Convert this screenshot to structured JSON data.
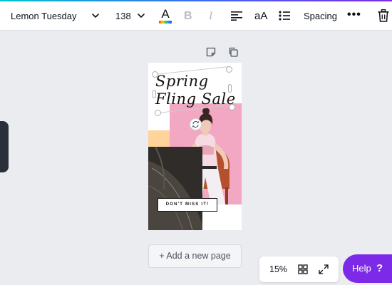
{
  "toolbar": {
    "font_name": "Lemon Tuesday",
    "font_size": "138",
    "text_color_letter": "A",
    "bold_label": "B",
    "italic_label": "I",
    "case_label": "aA",
    "spacing_label": "Spacing",
    "more_label": "•••"
  },
  "design": {
    "headline": "Spring Fling Sale",
    "cta": "DON'T MISS IT!"
  },
  "canvas": {
    "add_page_label": "+ Add a new page"
  },
  "footer": {
    "zoom": "15%",
    "help_label": "Help",
    "help_icon": "?"
  },
  "colors": {
    "accent": "#7d2ae8",
    "pink": "#f2a8c2",
    "peach": "#ffd39a",
    "canvas_bg": "#ebecf0"
  }
}
